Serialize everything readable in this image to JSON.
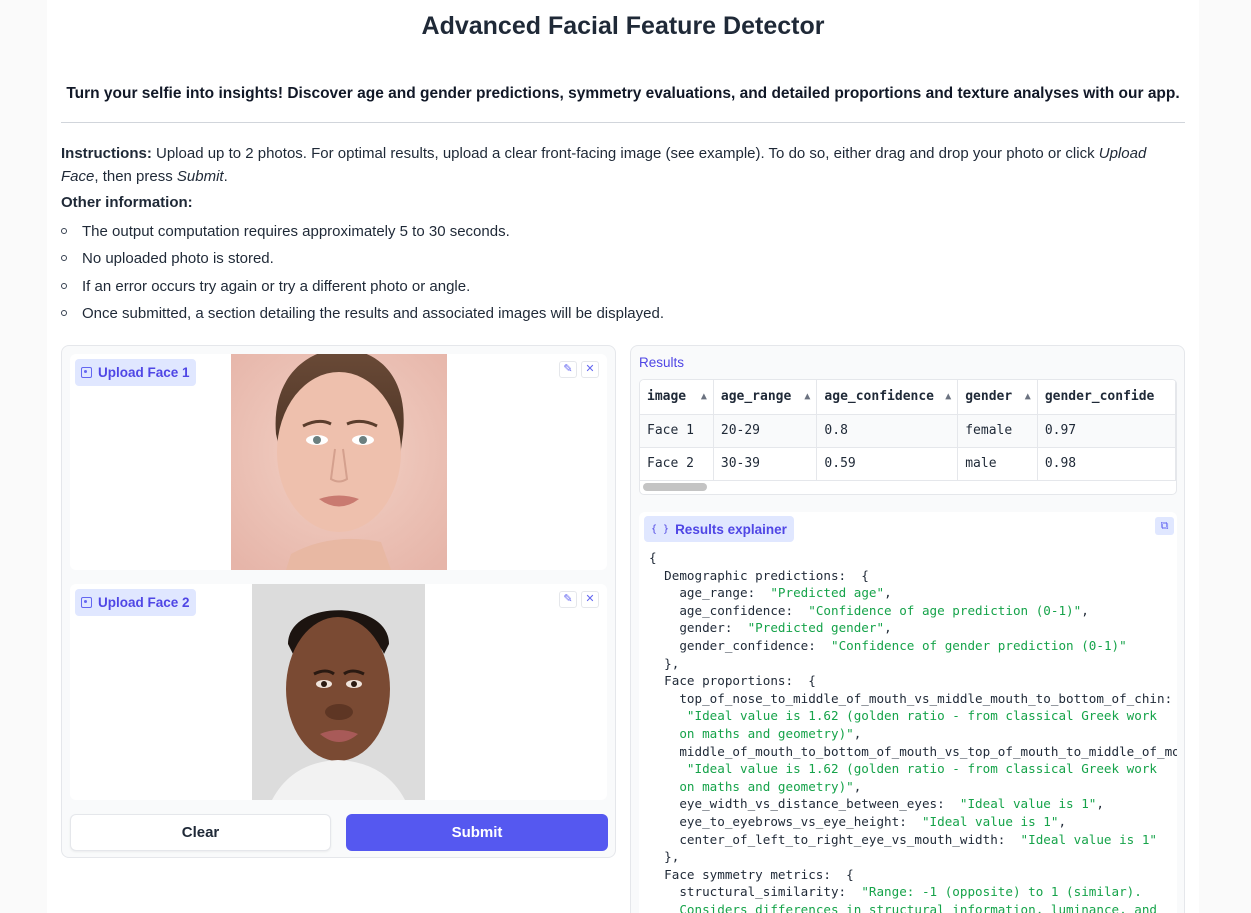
{
  "header": {
    "title": "Advanced Facial Feature Detector",
    "subtitle": "Turn your selfie into insights! Discover age and gender predictions, symmetry evaluations, and detailed proportions and texture analyses with our app."
  },
  "instructions": {
    "label": "Instructions:",
    "text1": " Upload up to 2 photos. For optimal results, upload a clear front-facing image (see example). To do so, either drag and drop your photo or click ",
    "upload_face": "Upload Face",
    "text2": ", then press ",
    "submit": "Submit",
    "text3": "."
  },
  "other_info": {
    "heading": "Other information:",
    "items": [
      "The output computation requires approximately 5 to 30 seconds.",
      "No uploaded photo is stored.",
      "If an error occurs try again or try a different photo or angle.",
      "Once submitted, a section detailing the results and associated images will be displayed."
    ]
  },
  "uploads": [
    {
      "label": "Upload Face 1"
    },
    {
      "label": "Upload Face 2"
    }
  ],
  "buttons": {
    "clear": "Clear",
    "submit": "Submit"
  },
  "results": {
    "label": "Results",
    "columns": [
      "image",
      "age_range",
      "age_confidence",
      "gender",
      "gender_confide"
    ],
    "rows": [
      [
        "Face 1",
        "20-29",
        "0.8",
        "female",
        "0.97"
      ],
      [
        "Face 2",
        "30-39",
        "0.59",
        "male",
        "0.98"
      ]
    ]
  },
  "explainer": {
    "label": "Results explainer",
    "lines": [
      [
        [
          "p",
          "{"
        ]
      ],
      [
        [
          "p",
          "  Demographic predictions:  {"
        ]
      ],
      [
        [
          "p",
          "    age_range:  "
        ],
        [
          "s",
          "\"Predicted age\""
        ],
        [
          "p",
          ","
        ]
      ],
      [
        [
          "p",
          "    age_confidence:  "
        ],
        [
          "s",
          "\"Confidence of age prediction (0-1)\""
        ],
        [
          "p",
          ","
        ]
      ],
      [
        [
          "p",
          "    gender:  "
        ],
        [
          "s",
          "\"Predicted gender\""
        ],
        [
          "p",
          ","
        ]
      ],
      [
        [
          "p",
          "    gender_confidence:  "
        ],
        [
          "s",
          "\"Confidence of gender prediction (0-1)\""
        ]
      ],
      [
        [
          "p",
          "  },"
        ]
      ],
      [
        [
          "p",
          "  Face proportions:  {"
        ]
      ],
      [
        [
          "p",
          "    top_of_nose_to_middle_of_mouth_vs_middle_mouth_to_bottom_of_chin:"
        ]
      ],
      [
        [
          "p",
          "     "
        ],
        [
          "s",
          "\"Ideal value is 1.62 (golden ratio - from classical Greek work"
        ]
      ],
      [
        [
          "p",
          "    "
        ],
        [
          "s",
          "on maths and geometry)\""
        ],
        [
          "p",
          ","
        ]
      ],
      [
        [
          "p",
          "    middle_of_mouth_to_bottom_of_mouth_vs_top_of_mouth_to_middle_of_mouth"
        ]
      ],
      [
        [
          "p",
          "     "
        ],
        [
          "s",
          "\"Ideal value is 1.62 (golden ratio - from classical Greek work"
        ]
      ],
      [
        [
          "p",
          "    "
        ],
        [
          "s",
          "on maths and geometry)\""
        ],
        [
          "p",
          ","
        ]
      ],
      [
        [
          "p",
          "    eye_width_vs_distance_between_eyes:  "
        ],
        [
          "s",
          "\"Ideal value is 1\""
        ],
        [
          "p",
          ","
        ]
      ],
      [
        [
          "p",
          "    eye_to_eyebrows_vs_eye_height:  "
        ],
        [
          "s",
          "\"Ideal value is 1\""
        ],
        [
          "p",
          ","
        ]
      ],
      [
        [
          "p",
          "    center_of_left_to_right_eye_vs_mouth_width:  "
        ],
        [
          "s",
          "\"Ideal value is 1\""
        ]
      ],
      [
        [
          "p",
          "  },"
        ]
      ],
      [
        [
          "p",
          "  Face symmetry metrics:  {"
        ]
      ],
      [
        [
          "p",
          "    structural_similarity:  "
        ],
        [
          "s",
          "\"Range: -1 (opposite) to 1 (similar)."
        ]
      ],
      [
        [
          "p",
          "    "
        ],
        [
          "s",
          "Considers differences in structural information, luminance, and"
        ]
      ]
    ]
  }
}
